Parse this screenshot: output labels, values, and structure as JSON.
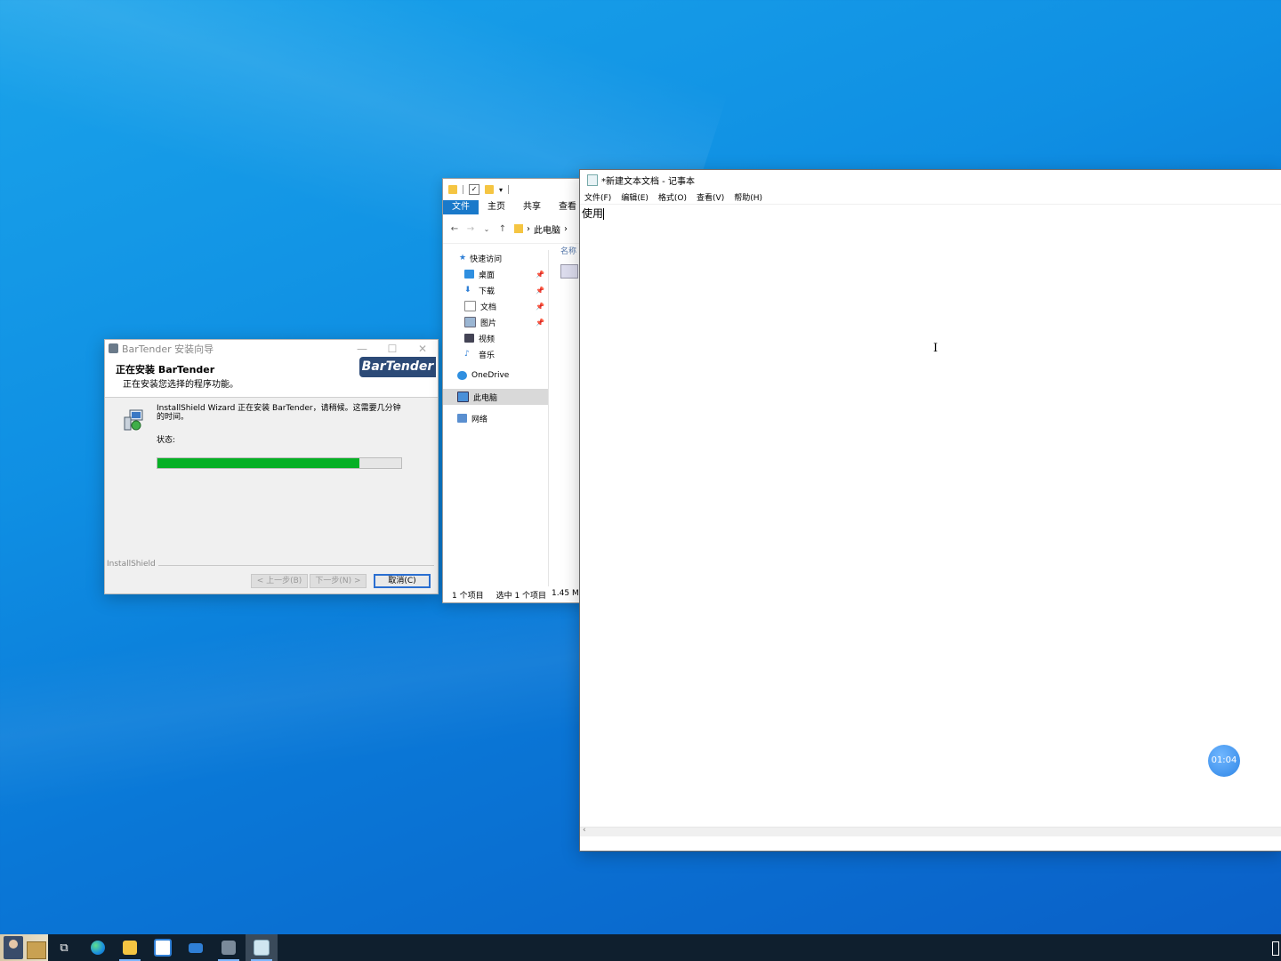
{
  "installer": {
    "title": "BarTender 安装向导",
    "heading": "正在安装 BarTender",
    "subheading": "正在安装您选择的程序功能。",
    "logo_text": "BarTender",
    "message": "InstallShield Wizard 正在安装 BarTender，请稍候。这需要几分钟的时间。",
    "status_label": "状态:",
    "progress_percent": 83,
    "footer_brand": "InstallShield",
    "back_button": "< 上一步(B)",
    "next_button": "下一步(N) >",
    "cancel_button": "取消(C)"
  },
  "explorer": {
    "ribbon_tabs": [
      "文件",
      "主页",
      "共享",
      "查看"
    ],
    "address_path": "此电脑",
    "column_header": "名称",
    "nav": {
      "quick_access": "快速访问",
      "desktop": "桌面",
      "downloads": "下载",
      "documents": "文档",
      "pictures": "图片",
      "videos": "视频",
      "music": "音乐",
      "onedrive": "OneDrive",
      "this_pc": "此电脑",
      "network": "网络"
    },
    "status": {
      "item_count": "1 个项目",
      "selected": "选中 1 个项目",
      "size": "1.45 M"
    }
  },
  "notepad": {
    "title": "*新建文本文档 - 记事本",
    "menu": [
      "文件(F)",
      "编辑(E)",
      "格式(O)",
      "查看(V)",
      "帮助(H)"
    ],
    "content": "使用"
  },
  "timer": "01:04",
  "colors": {
    "progress_fill": "#06b025",
    "ribbon_active": "#1979ca",
    "desktop": "#0f8fe3",
    "taskbar": "#0f1f2e"
  }
}
